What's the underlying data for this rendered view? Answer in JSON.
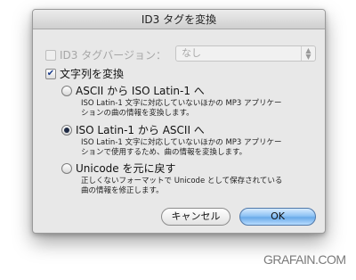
{
  "dialog": {
    "title": "ID3 タグを変換",
    "id3_version": {
      "label": "ID3 タグバージョン：",
      "checked": false,
      "enabled": false,
      "select_value": "なし"
    },
    "convert_text": {
      "label": "文字列を変換",
      "checked": true
    },
    "options": [
      {
        "label": "ASCII から ISO Latin-1 へ",
        "selected": false,
        "description_line1": "ISO Latin-1 文字に対応していないほかの MP3 アプリケー",
        "description_line2": "ションの曲の情報を変換します。"
      },
      {
        "label": "ISO Latin-1 から ASCII へ",
        "selected": true,
        "description_line1": "ISO Latin-1 文字に対応していないほかの MP3 アプリケー",
        "description_line2": "ションで使用するため、曲の情報を変換します。"
      },
      {
        "label": "Unicode を元に戻す",
        "selected": false,
        "description_line1": "正しくないフォーマットで Unicode として保存されている",
        "description_line2": "曲の情報を修正します。"
      }
    ],
    "buttons": {
      "cancel": "キャンセル",
      "ok": "OK"
    }
  },
  "watermark": "GRAFAIN.COM",
  "colors": {
    "ok_button": "#6aaae9",
    "dialog_background": "#e8e8e8"
  }
}
